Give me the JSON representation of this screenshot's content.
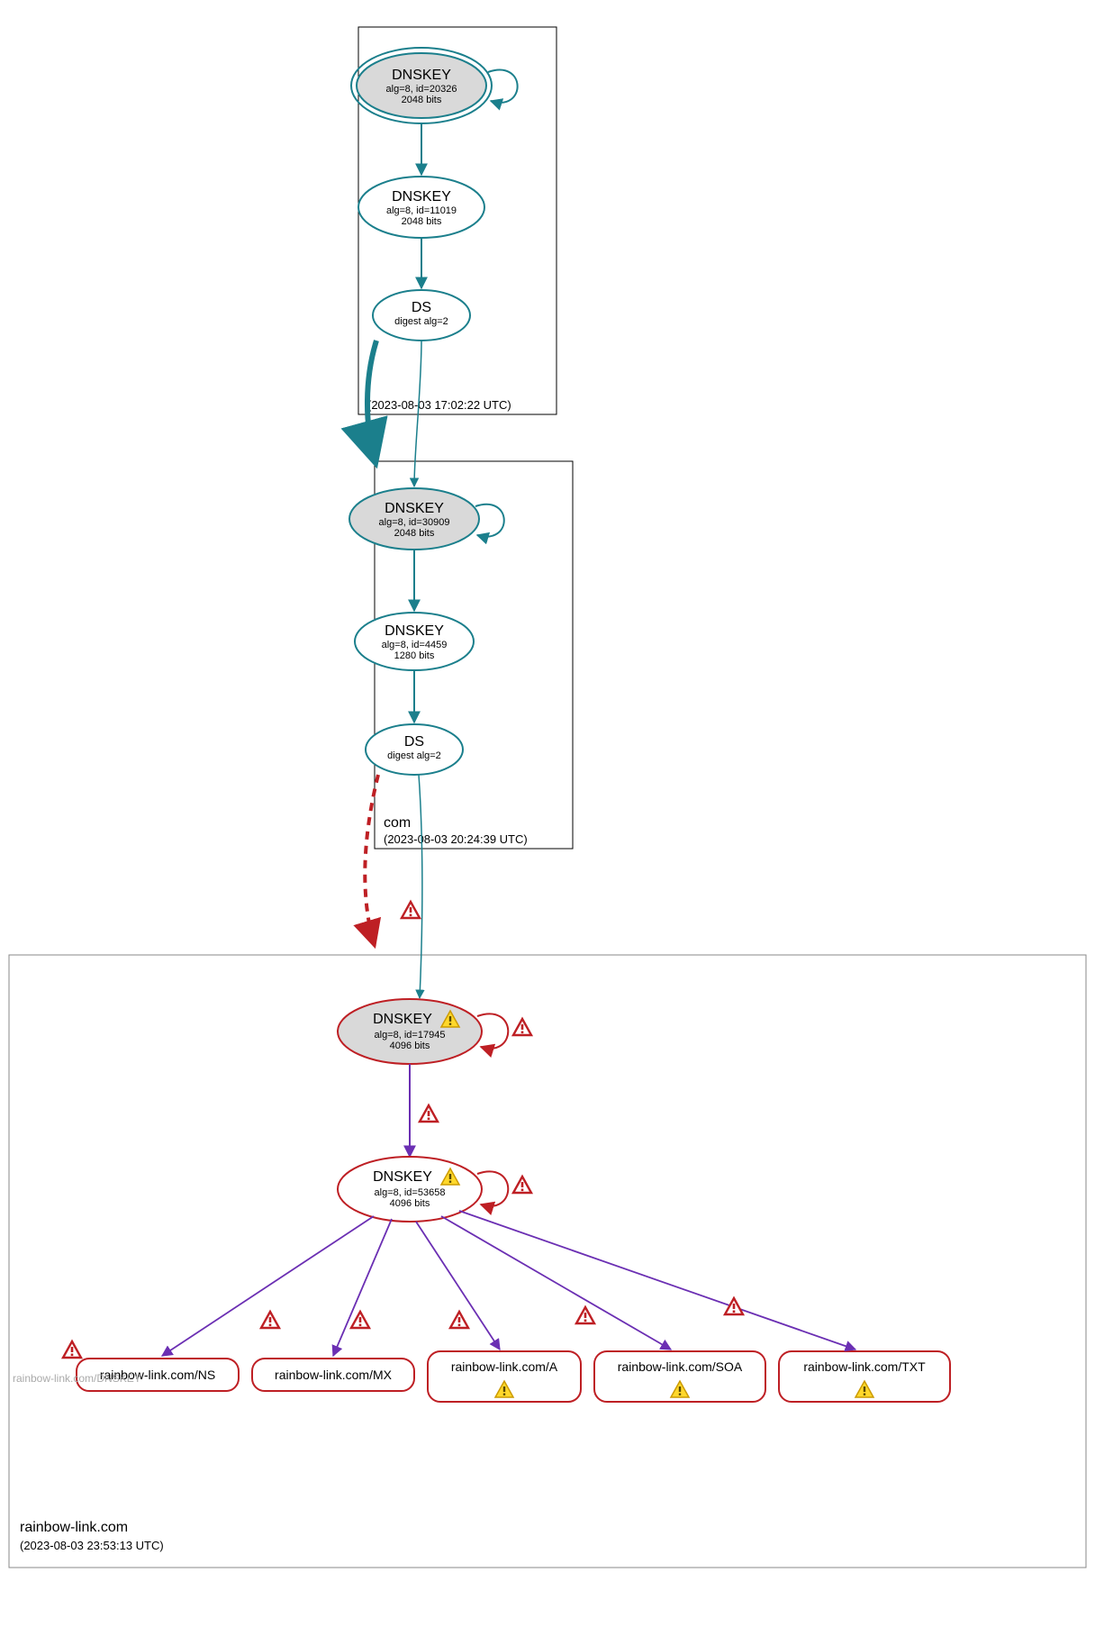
{
  "zones": {
    "root": {
      "name": ".",
      "time": "(2023-08-03 17:02:22 UTC)"
    },
    "com": {
      "name": "com",
      "time": "(2023-08-03 20:24:39 UTC)"
    },
    "domain": {
      "name": "rainbow-link.com",
      "time": "(2023-08-03 23:53:13 UTC)"
    }
  },
  "nodes": {
    "root_ksk": {
      "title": "DNSKEY",
      "line1": "alg=8, id=20326",
      "line2": "2048 bits"
    },
    "root_zsk": {
      "title": "DNSKEY",
      "line1": "alg=8, id=11019",
      "line2": "2048 bits"
    },
    "root_ds": {
      "title": "DS",
      "line1": "digest alg=2",
      "line2": ""
    },
    "com_ksk": {
      "title": "DNSKEY",
      "line1": "alg=8, id=30909",
      "line2": "2048 bits"
    },
    "com_zsk": {
      "title": "DNSKEY",
      "line1": "alg=8, id=4459",
      "line2": "1280 bits"
    },
    "com_ds": {
      "title": "DS",
      "line1": "digest alg=2",
      "line2": ""
    },
    "dom_ksk": {
      "title": "DNSKEY",
      "line1": "alg=8, id=17945",
      "line2": "4096 bits"
    },
    "dom_zsk": {
      "title": "DNSKEY",
      "line1": "alg=8, id=53658",
      "line2": "4096 bits"
    }
  },
  "rrsets": {
    "ns": "rainbow-link.com/NS",
    "mx": "rainbow-link.com/MX",
    "a": "rainbow-link.com/A",
    "soa": "rainbow-link.com/SOA",
    "txt": "rainbow-link.com/TXT",
    "dnskey_gray": "rainbow-link.com/DNSKEY"
  },
  "colors": {
    "teal": "#1b7f8c",
    "red": "#be1f24",
    "purple": "#6b2fb3",
    "gray_fill": "#d9d9d9"
  }
}
